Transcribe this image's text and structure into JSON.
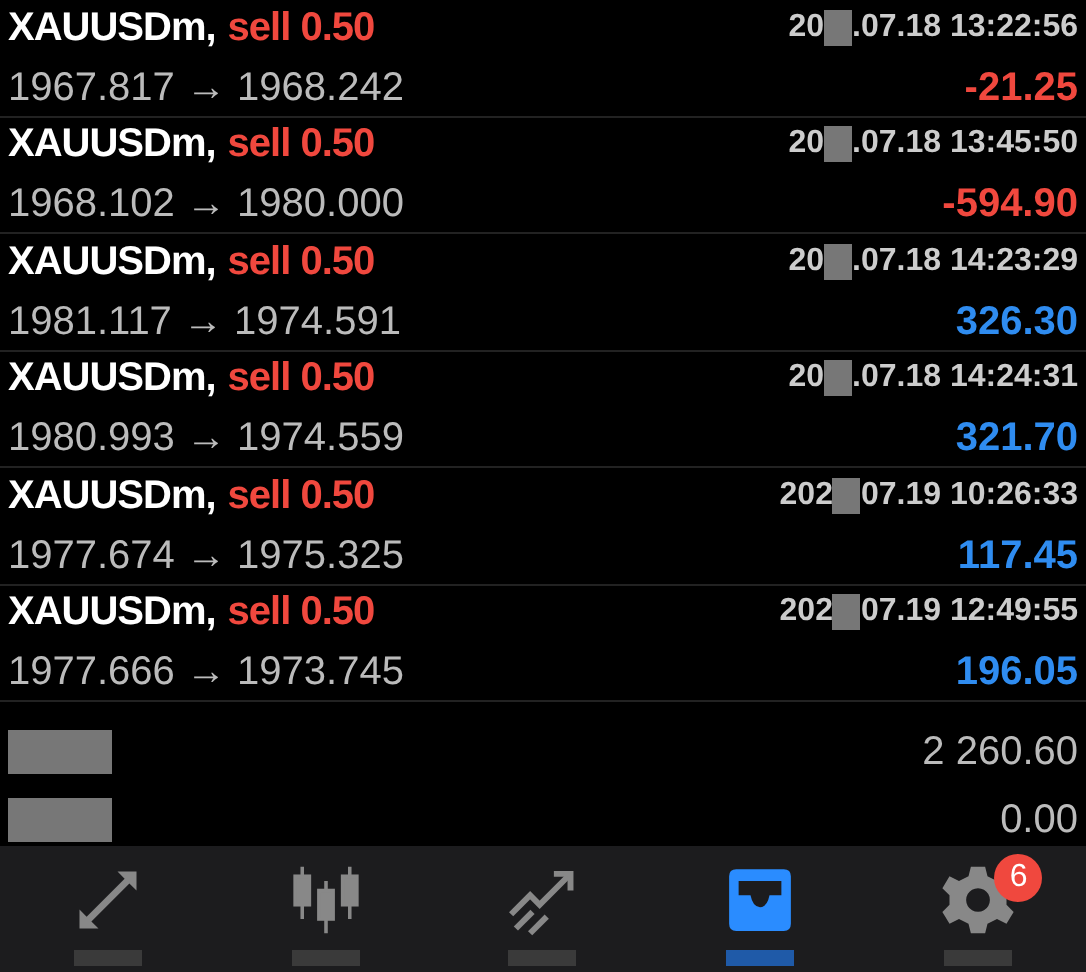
{
  "deals": [
    {
      "symbol": "XAUUSDm,",
      "side": "sell 0.50",
      "date_start": "20",
      "date_end": ".07.18 13:22:56",
      "prices": "1967.817 → 1968.242",
      "profit": "-21.25",
      "color": "#f0483e"
    },
    {
      "symbol": "XAUUSDm,",
      "side": "sell 0.50",
      "date_start": "20",
      "date_end": ".07.18 13:45:50",
      "prices": "1968.102 → 1980.000",
      "profit": "-594.90",
      "color": "#f0483e"
    },
    {
      "symbol": "XAUUSDm,",
      "side": "sell 0.50",
      "date_start": "20",
      "date_end": ".07.18 14:23:29",
      "prices": "1981.117 → 1974.591",
      "profit": "326.30",
      "color": "#2f8cf0"
    },
    {
      "symbol": "XAUUSDm,",
      "side": "sell 0.50",
      "date_start": "20",
      "date_end": ".07.18 14:24:31",
      "prices": "1980.993 → 1974.559",
      "profit": "321.70",
      "color": "#2f8cf0"
    },
    {
      "symbol": "XAUUSDm,",
      "side": "sell 0.50",
      "date_start": "202",
      "date_end": "07.19 10:26:33",
      "prices": "1977.674 → 1975.325",
      "profit": "117.45",
      "color": "#2f8cf0"
    },
    {
      "symbol": "XAUUSDm,",
      "side": "sell 0.50",
      "date_start": "202",
      "date_end": "07.19 12:49:55",
      "prices": "1977.666 → 1973.745",
      "profit": "196.05",
      "color": "#2f8cf0"
    }
  ],
  "summary": [
    {
      "value": "2 260.60"
    },
    {
      "value": "0.00"
    }
  ],
  "tabs": [
    {
      "kind": "trade",
      "selected": false
    },
    {
      "kind": "quotes",
      "selected": false
    },
    {
      "kind": "chart",
      "selected": false
    },
    {
      "kind": "history",
      "selected": true
    },
    {
      "kind": "settings",
      "selected": false,
      "badge": "6"
    }
  ]
}
